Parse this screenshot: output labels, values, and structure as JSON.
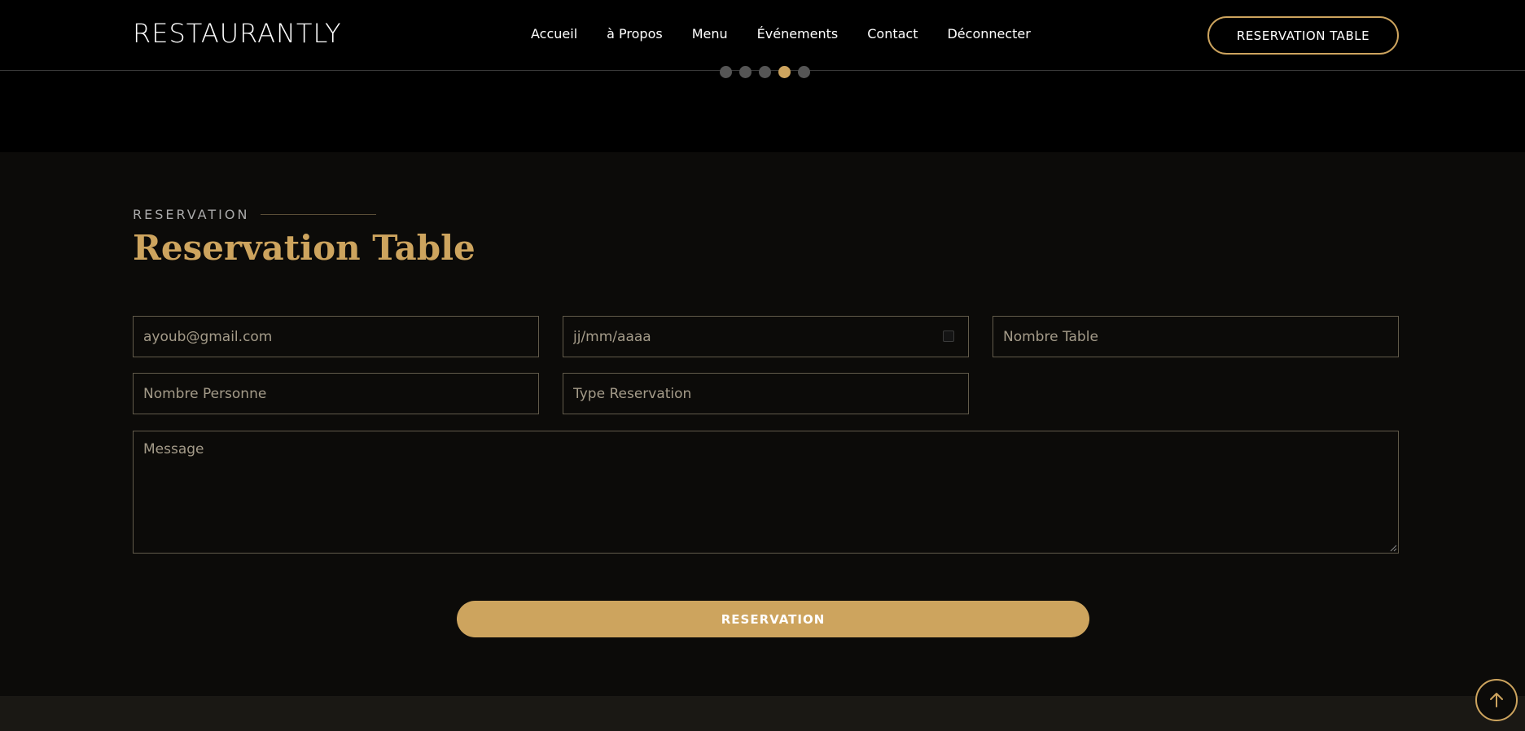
{
  "header": {
    "logo": "RESTAURANTLY",
    "nav": [
      "Accueil",
      "à Propos",
      "Menu",
      "Événements",
      "Contact",
      "Déconnecter"
    ],
    "book_button": "RESERVATION TABLE"
  },
  "hero": {
    "slide_count": 5,
    "active_slide": 4
  },
  "section": {
    "eyebrow": "RESERVATION",
    "title": "Reservation Table"
  },
  "form": {
    "email_placeholder": "ayoub@gmail.com",
    "date_placeholder": "jj/mm/aaaa",
    "table_placeholder": "Nombre Table",
    "persons_placeholder": "Nombre Personne",
    "type_placeholder": "Type Reservation",
    "message_placeholder": "Message",
    "submit_label": "RESERVATION"
  },
  "colors": {
    "accent": "#cda45e",
    "background": "#0c0b09"
  },
  "icons": {
    "calendar": "calendar-icon",
    "back_to_top": "arrow-up-icon"
  }
}
